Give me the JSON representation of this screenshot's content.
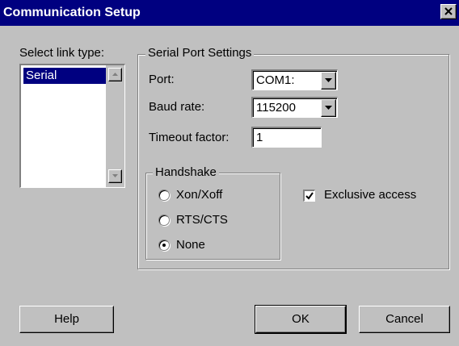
{
  "window": {
    "title": "Communication Setup",
    "close_glyph": "×"
  },
  "link_type": {
    "label": "Select link type:",
    "items": [
      "Serial"
    ],
    "selected_index": 0
  },
  "serial": {
    "group_label": "Serial Port Settings",
    "port_label": "Port:",
    "port_value": "COM1:",
    "baud_label": "Baud rate:",
    "baud_value": "115200",
    "timeout_label": "Timeout factor:",
    "timeout_value": "1"
  },
  "handshake": {
    "group_label": "Handshake",
    "options": [
      "Xon/Xoff",
      "RTS/CTS",
      "None"
    ],
    "selected": "None"
  },
  "exclusive": {
    "label": "Exclusive access",
    "checked": true
  },
  "buttons": {
    "help": "Help",
    "ok": "OK",
    "cancel": "Cancel"
  },
  "colors": {
    "title_bar": "#000080",
    "face": "#c0c0c0",
    "selection": "#000080"
  }
}
